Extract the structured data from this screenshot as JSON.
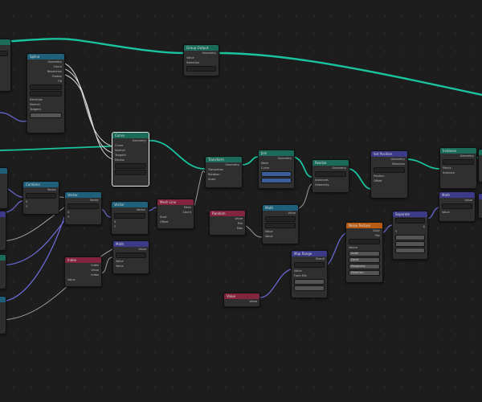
{
  "editor": {
    "name": "Geometry Nodes Editor"
  },
  "colors": {
    "geometry_wire": "#19c49e",
    "vector_wire": "#6b6bd8",
    "float_wire": "#9c9c9c",
    "header_geometry": "#1b6b5a",
    "header_vector": "#3b3b8a",
    "header_converter": "#1e5f7a",
    "header_input": "#84253f",
    "header_texture": "#b85c14"
  },
  "nodes": {
    "n_top_left": {
      "title": "Spline",
      "rows": [
        "Geometry",
        "Count",
        "Resolution",
        "Radius",
        "Tilt",
        "Selection",
        "Normal",
        "Tangent"
      ]
    },
    "n_group_out": {
      "title": "Group Output",
      "rows": [
        "Geometry",
        "Value",
        "Selection"
      ]
    },
    "n_curve": {
      "title": "Curve",
      "rows": [
        "Geometry",
        "Curve",
        "Normal",
        "Tangent",
        "Radius"
      ]
    },
    "n_join": {
      "title": "Join",
      "rows": [
        "Geometry",
        "Mesh",
        "Curve"
      ]
    },
    "n_realize": {
      "title": "Realize",
      "rows": [
        "Geometry",
        "Instances"
      ]
    },
    "n_transform": {
      "title": "Transform",
      "rows": [
        "Geometry",
        "Translation",
        "Rotation",
        "Scale"
      ]
    },
    "n_set_pos": {
      "title": "Set Position",
      "rows": [
        "Geometry",
        "Selection",
        "Position",
        "Offset"
      ]
    },
    "n_instance": {
      "title": "Instance",
      "rows": [
        "Geometry",
        "Points",
        "Instance",
        "Scale"
      ]
    },
    "n_mesh_line": {
      "title": "Mesh Line",
      "rows": [
        "Mesh",
        "Count",
        "Start",
        "Offset"
      ]
    },
    "n_vec_a": {
      "title": "Vector",
      "rows": [
        "Vector",
        "X",
        "Y",
        "Z"
      ]
    },
    "n_vec_b": {
      "title": "Vector",
      "rows": [
        "Vector",
        "X",
        "Y"
      ]
    },
    "n_combine": {
      "title": "Combine",
      "rows": [
        "Vector",
        "X",
        "Y",
        "Z"
      ]
    },
    "n_math_a": {
      "title": "Math",
      "rows": [
        "Value",
        "Value",
        "Value"
      ]
    },
    "n_math_b": {
      "title": "Math",
      "rows": [
        "Value",
        "Value",
        "Value"
      ]
    },
    "n_index": {
      "title": "Index",
      "rows": [
        "Index",
        "Value"
      ]
    },
    "n_random": {
      "title": "Random",
      "rows": [
        "Value",
        "Min",
        "Max",
        "Seed"
      ]
    },
    "n_value": {
      "title": "Value",
      "rows": [
        "Value"
      ]
    },
    "n_noise": {
      "title": "Noise Texture",
      "rows": [
        "Color",
        "Fac",
        "Vector",
        "Scale",
        "Detail",
        "Roughness",
        "Distortion"
      ]
    },
    "n_map": {
      "title": "Map Range",
      "rows": [
        "Result",
        "Value",
        "From Min",
        "From Max"
      ]
    },
    "n_sep": {
      "title": "Separate",
      "rows": [
        "X",
        "Y",
        "Z"
      ]
    },
    "n_right_a": {
      "title": "Set Radius",
      "rows": [
        "Curve",
        "Selection",
        "Radius",
        "Length"
      ]
    },
    "n_right_b": {
      "title": "Math",
      "rows": [
        "Value",
        "Value"
      ]
    }
  }
}
